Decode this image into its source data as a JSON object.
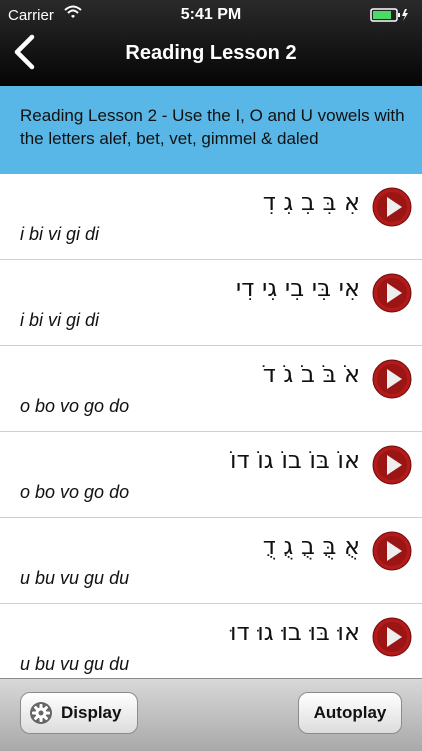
{
  "status_bar": {
    "carrier": "Carrier",
    "time": "5:41 PM"
  },
  "nav": {
    "title": "Reading Lesson 2"
  },
  "banner": {
    "text": "Reading Lesson 2 - Use the I, O and U vowels with the letters alef, bet, vet, gimmel & daled"
  },
  "lessons": [
    {
      "hebrew": "אִ בִּ בִ גִ דִ",
      "translit": "i bi vi gi di"
    },
    {
      "hebrew": "אִי בִּי בִי גִי דִי",
      "translit": "i bi vi gi di"
    },
    {
      "hebrew": "אֹ בֹּ בֹ גֹ דֹ",
      "translit": "o bo vo go do"
    },
    {
      "hebrew": "אוֹ בּוֹ בוֹ גוֹ דוֹ",
      "translit": "o bo vo go do"
    },
    {
      "hebrew": "אֻ בֻּ בֻ גֻ דֻ",
      "translit": "u bu vu gu du"
    },
    {
      "hebrew": "אוּ בּוּ בוּ גוּ דוּ",
      "translit": "u bu vu gu du"
    }
  ],
  "toolbar": {
    "display_label": "Display",
    "autoplay_label": "Autoplay"
  },
  "colors": {
    "banner": "#58b7e6",
    "play_button": "#b31a1a",
    "nav_bar": "#111111"
  },
  "icons": {
    "back": "chevron-left-icon",
    "play": "play-icon",
    "settings": "gear-icon",
    "wifi": "wifi-icon",
    "battery": "battery-icon"
  }
}
